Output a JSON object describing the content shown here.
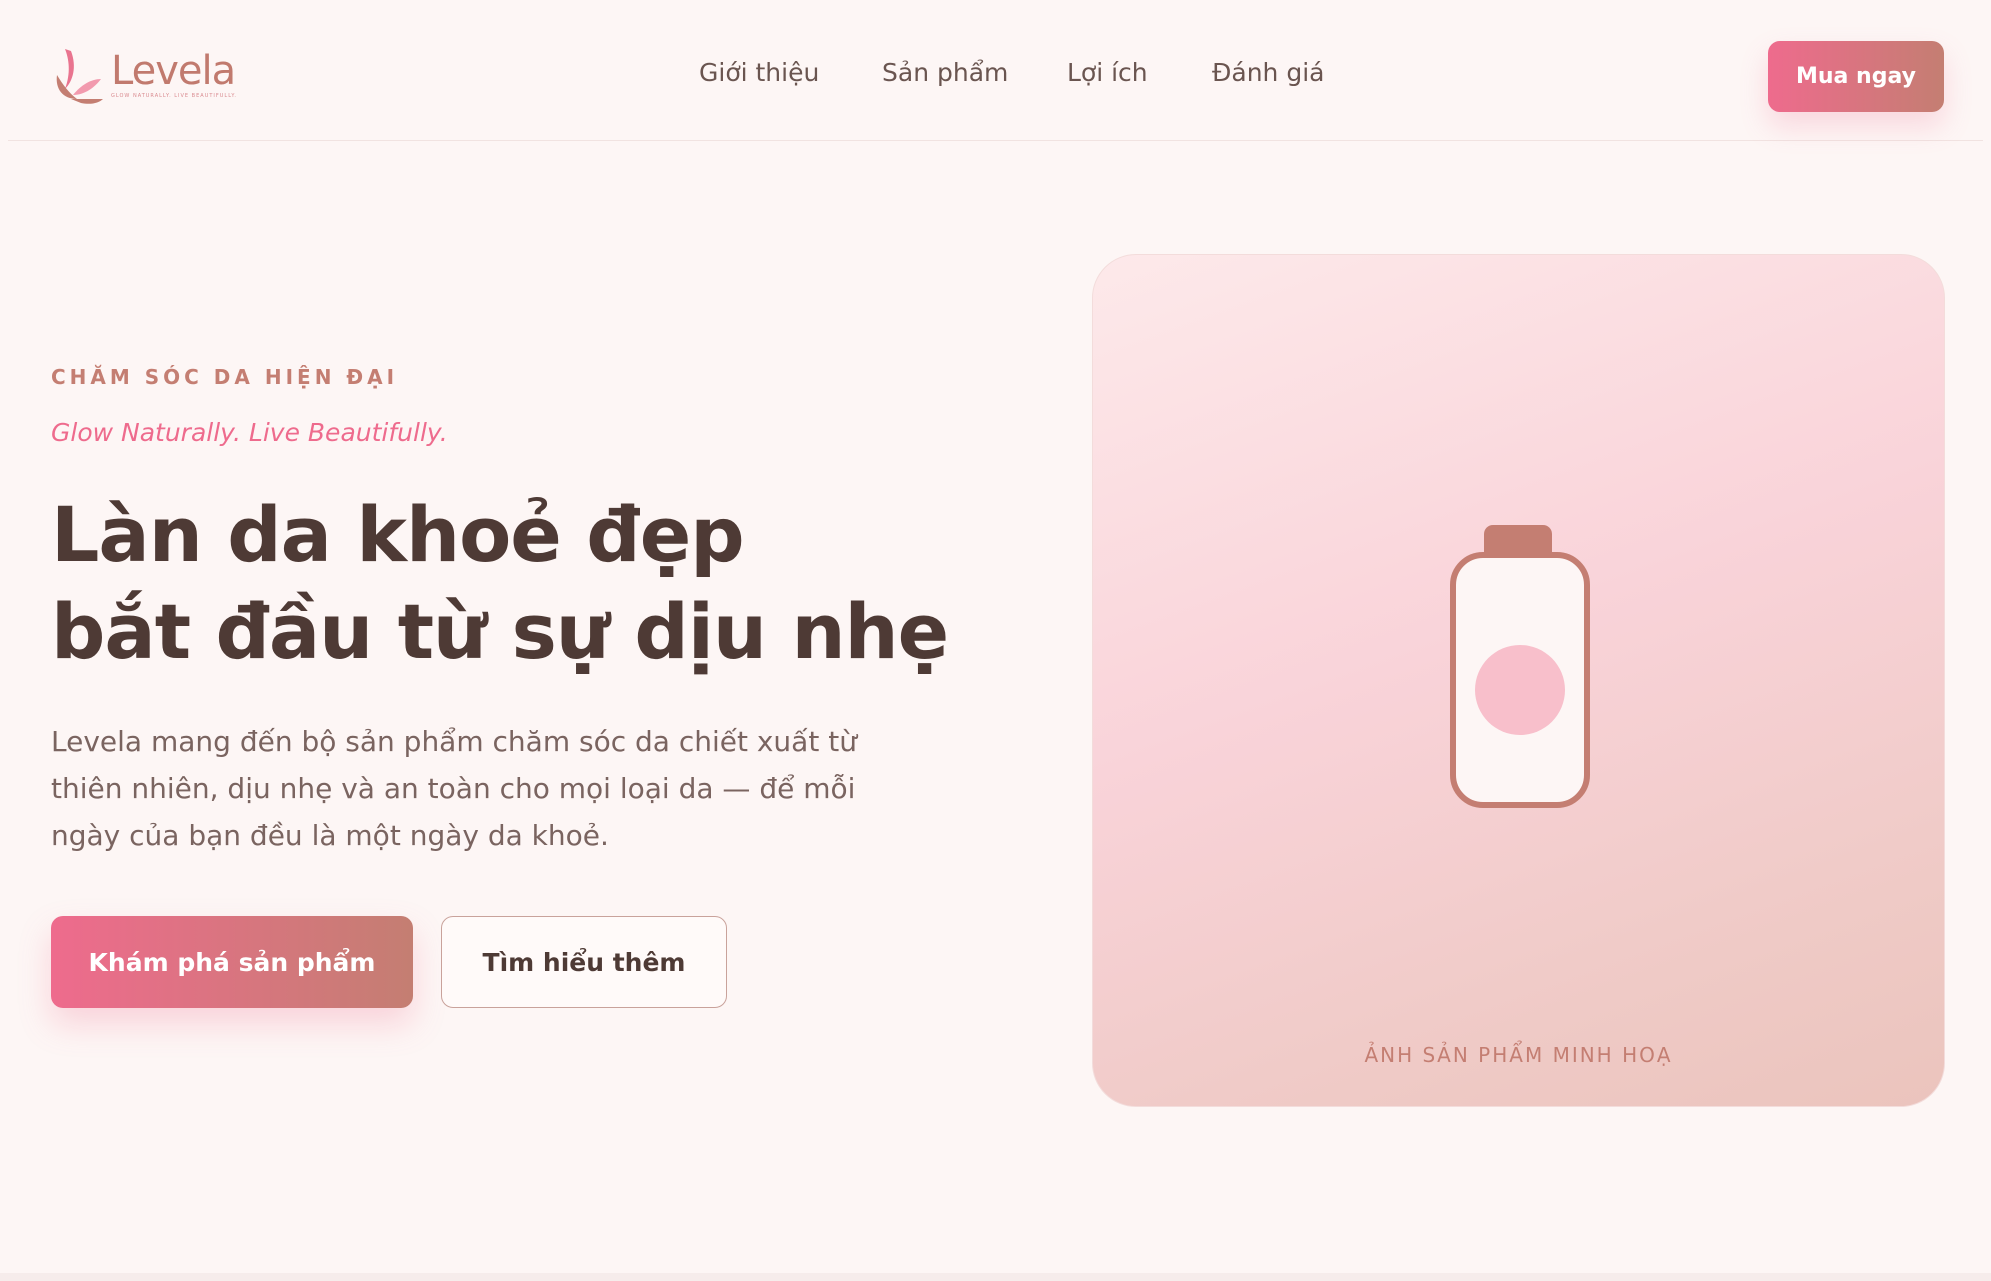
{
  "brand": {
    "name": "Levela",
    "tagline": "GLOW NATURALLY. LIVE BEAUTIFULLY."
  },
  "nav": {
    "items": [
      {
        "label": "Giới thiệu"
      },
      {
        "label": "Sản phẩm"
      },
      {
        "label": "Lợi ích"
      },
      {
        "label": "Đánh giá"
      }
    ],
    "cta": "Mua ngay"
  },
  "hero": {
    "eyebrow": "CHĂM SÓC DA HIỆN ĐẠI",
    "tagline": "Glow Naturally. Live Beautifully.",
    "headline_line1": "Làn da khoẻ đẹp",
    "headline_line2": "bắt đầu từ sự dịu nhẹ",
    "description": "Levela mang đến bộ sản phẩm chăm sóc da chiết xuất từ thiên nhiên, dịu nhẹ và an toàn cho mọi loại da — để mỗi ngày của bạn đều là một ngày da khoẻ.",
    "primary_button": "Khám phá sản phẩm",
    "secondary_button": "Tìm hiểu thêm"
  },
  "product_card": {
    "caption": "ẢNH SẢN PHẨM MINH HOẠ",
    "icon": "bottle-icon"
  },
  "colors": {
    "accent_pink": "#ee6b8d",
    "accent_rose": "#c47e72",
    "text_dark": "#4e3a35",
    "background": "#fdf6f5"
  }
}
